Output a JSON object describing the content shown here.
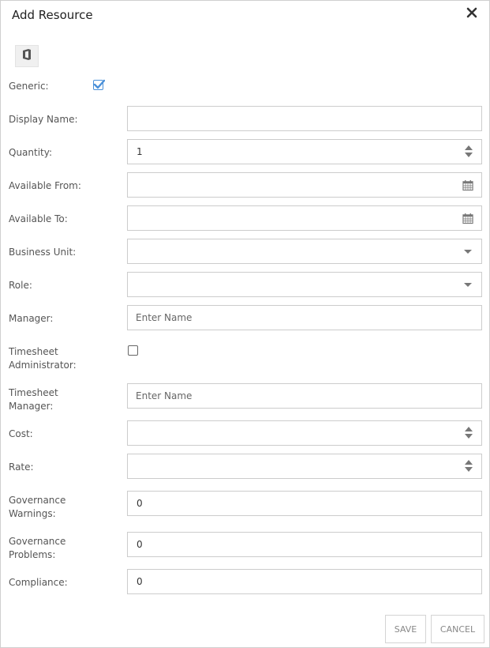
{
  "dialog": {
    "title": "Add Resource",
    "close_icon": "close-icon"
  },
  "toolbar": {
    "office_icon": "office-icon"
  },
  "form": {
    "generic": {
      "label": "Generic:",
      "checked": true
    },
    "display_name": {
      "label": "Display Name:",
      "value": ""
    },
    "quantity": {
      "label": "Quantity:",
      "value": "1"
    },
    "available_from": {
      "label": "Available From:",
      "value": ""
    },
    "available_to": {
      "label": "Available To:",
      "value": ""
    },
    "business_unit": {
      "label": "Business Unit:",
      "value": ""
    },
    "role": {
      "label": "Role:",
      "value": ""
    },
    "manager": {
      "label": "Manager:",
      "placeholder": "Enter Name"
    },
    "timesheet_administrator": {
      "label": "Timesheet\nAdministrator:",
      "checked": false
    },
    "timesheet_manager": {
      "label": "Timesheet\nManager:",
      "placeholder": "Enter Name"
    },
    "cost": {
      "label": "Cost:",
      "value": ""
    },
    "rate": {
      "label": "Rate:",
      "value": ""
    },
    "governance_warnings": {
      "label": "Governance\nWarnings:",
      "value": "0"
    },
    "governance_problems": {
      "label": "Governance\nProblems:",
      "value": "0"
    },
    "compliance": {
      "label": "Compliance:",
      "value": "0"
    }
  },
  "footer": {
    "save_label": "SAVE",
    "cancel_label": "CANCEL"
  },
  "colors": {
    "check_accent": "#4a90d9",
    "border": "#cccccc",
    "label_text": "#555555"
  }
}
